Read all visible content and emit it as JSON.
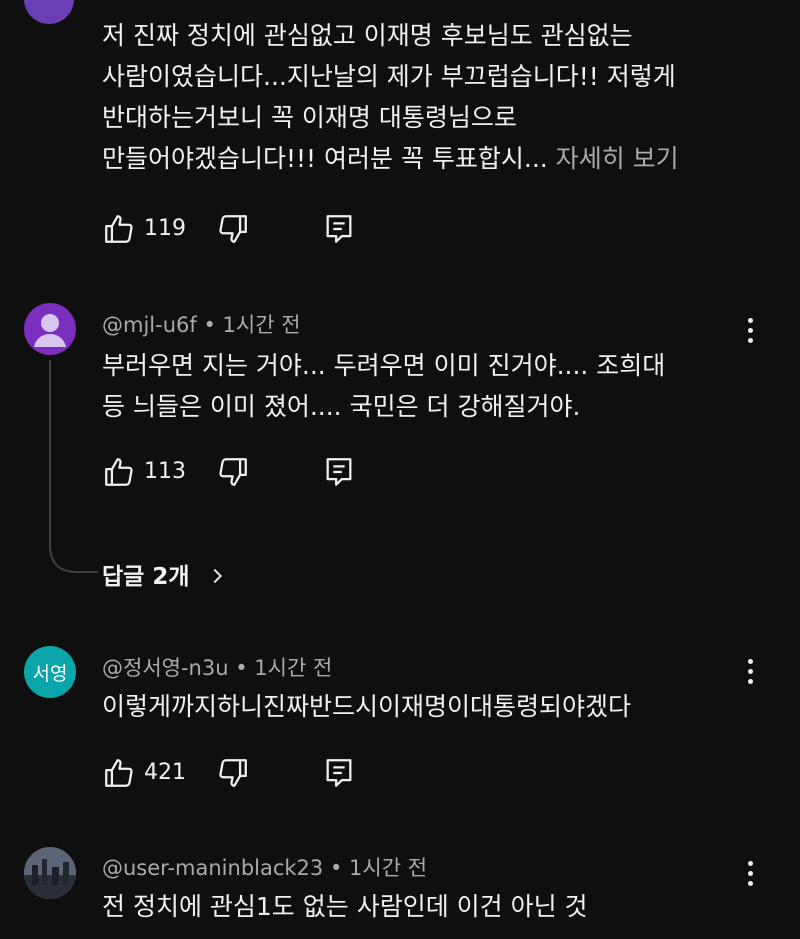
{
  "comments": [
    {
      "id": "c1",
      "body_lines": [
        "저 진짜 정치에 관심없고 이재명 후보님도 관심없는",
        "사람이였습니다...지난날의 제가 부끄럽습니다!! 저렇게",
        "반대하는거보니 꼭 이재명 대통령님으로",
        "만들어야겠습니다!!! 여러분 꼭 투표합시..."
      ],
      "read_more": "자세히 보기",
      "likes": "119",
      "avatar_color": "#6a3fb5"
    },
    {
      "id": "c2",
      "handle": "@mjl-u6f",
      "time": "1시간 전",
      "body_lines": [
        "부러우면 지는 거야... 두려우면 이미 진거야.... 조희대",
        "등 늬들은 이미 졌어.... 국민은 더 강해질거야."
      ],
      "likes": "113",
      "replies_label": "답글 2개",
      "avatar_color": "#7b2fbe"
    },
    {
      "id": "c3",
      "handle": "@정서영-n3u",
      "time": "1시간 전",
      "avatar_text": "서영",
      "body_lines": [
        "이렇게까지하니진짜반드시이재명이대통령되야겠다"
      ],
      "likes": "421",
      "avatar_color": "#0aa5a8"
    },
    {
      "id": "c4",
      "handle": "@user-maninblack23",
      "time": "1시간 전",
      "body_lines": [
        "전 정치에 관심1도 없는 사람인데 이건 아닌 것"
      ]
    }
  ],
  "separator": "•",
  "icons": {
    "like": "thumb-up-icon",
    "dislike": "thumb-down-icon",
    "reply": "comment-icon",
    "menu": "more-vert-icon",
    "replies_chevron": "chevron-right-icon"
  }
}
